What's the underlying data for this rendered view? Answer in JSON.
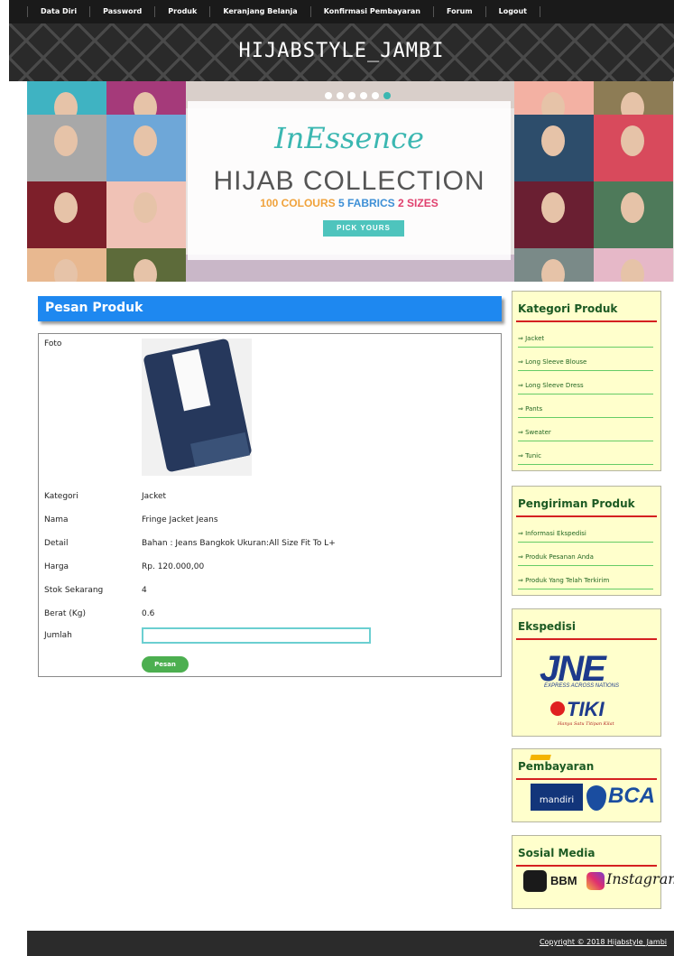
{
  "nav": [
    "Data Diri",
    "Password",
    "Produk",
    "Keranjang Belanja",
    "Konfirmasi Pembayaran",
    "Forum",
    "Logout"
  ],
  "site_title": "HIJABSTYLE_JAMBI",
  "banner": {
    "logo": "InEssence",
    "title": "HIJAB COLLECTION",
    "sub_1": "100 COLOURS",
    "sub_2": "5 FABRICS",
    "sub_3": "2 SIZES",
    "button": "PICK YOURS"
  },
  "main": {
    "heading": "Pesan Produk",
    "labels": {
      "foto": "Foto",
      "kategori": "Kategori",
      "nama": "Nama",
      "detail": "Detail",
      "harga": "Harga",
      "stok": "Stok Sekarang",
      "berat": "Berat (Kg)",
      "jumlah": "Jumlah"
    },
    "values": {
      "kategori": "Jacket",
      "nama": "Fringe Jacket Jeans",
      "detail": "Bahan : Jeans Bangkok Ukuran:All Size Fit To L+",
      "harga": "Rp. 120.000,00",
      "stok": "4",
      "berat": "0.6",
      "jumlah": ""
    },
    "order_button": "Pesan"
  },
  "sidebar": {
    "kategori_title": "Kategori Produk",
    "kategori_items": [
      "⇒ Jacket",
      "⇒ Long Sleeve Blouse",
      "⇒ Long Sleeve Dress",
      "⇒ Pants",
      "⇒ Sweater",
      "⇒ Tunic"
    ],
    "pengiriman_title": "Pengiriman Produk",
    "pengiriman_items": [
      "⇒ Informasi Ekspedisi",
      "⇒ Produk Pesanan Anda",
      "⇒ Produk Yang Telah Terkirim"
    ],
    "ekspedisi_title": "Ekspedisi",
    "jne": "JNE",
    "jne_sub": "EXPRESS ACROSS NATIONS",
    "tiki": "TIKI",
    "tiki_sub": "Hanya Satu Titipan Kilat",
    "pembayaran_title": "Pembayaran",
    "mandiri": "mandiri",
    "bca": "BCA",
    "sosial_title": "Sosial Media",
    "bbm": "BBM",
    "instagram": "Instagram"
  },
  "footer": {
    "copyright": "Copyright © 2018 Hijabstyle_Jambi"
  }
}
